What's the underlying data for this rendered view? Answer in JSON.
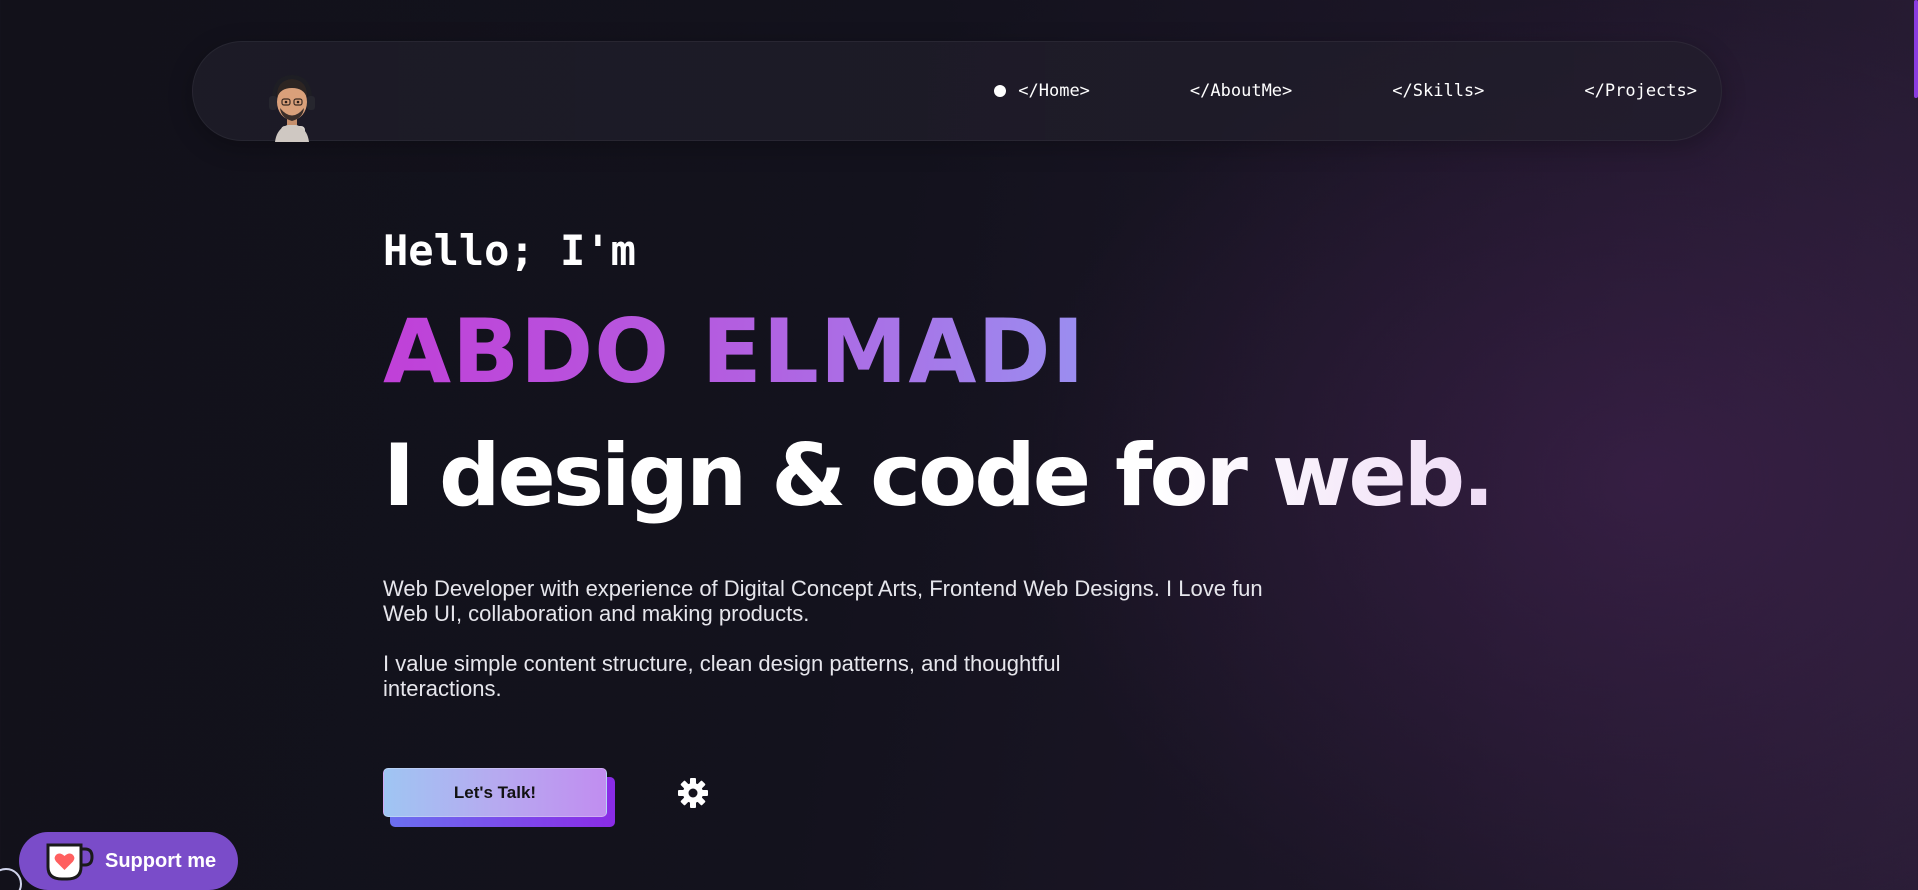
{
  "nav": {
    "avatar_icon": "avatar-memoji-icon",
    "links": [
      {
        "label": "</Home>",
        "active": true
      },
      {
        "label": "</AboutMe>",
        "active": false
      },
      {
        "label": "</Skills>",
        "active": false
      },
      {
        "label": "</Projects>",
        "active": false
      }
    ]
  },
  "hero": {
    "greeting": "Hello; I'm",
    "name": "ABDO ELMADI",
    "tagline": "I design & code for web.",
    "description_1": "Web Developer with experience of Digital Concept Arts, Frontend Web Designs. I Love fun Web UI, collaboration and making products.",
    "description_2": "I value simple content structure, clean design patterns, and thoughtful interactions.",
    "cta_label": "Let's Talk!",
    "settings_icon": "gear-icon"
  },
  "support": {
    "label": "Support me",
    "icon": "coffee-cup-heart-icon"
  },
  "colors": {
    "name_gradient_start": "#c040d8",
    "name_gradient_end": "#9a8ef0",
    "accent": "#8b3ce0",
    "support_bg": "#7a4cc9",
    "background": "#13121d"
  }
}
